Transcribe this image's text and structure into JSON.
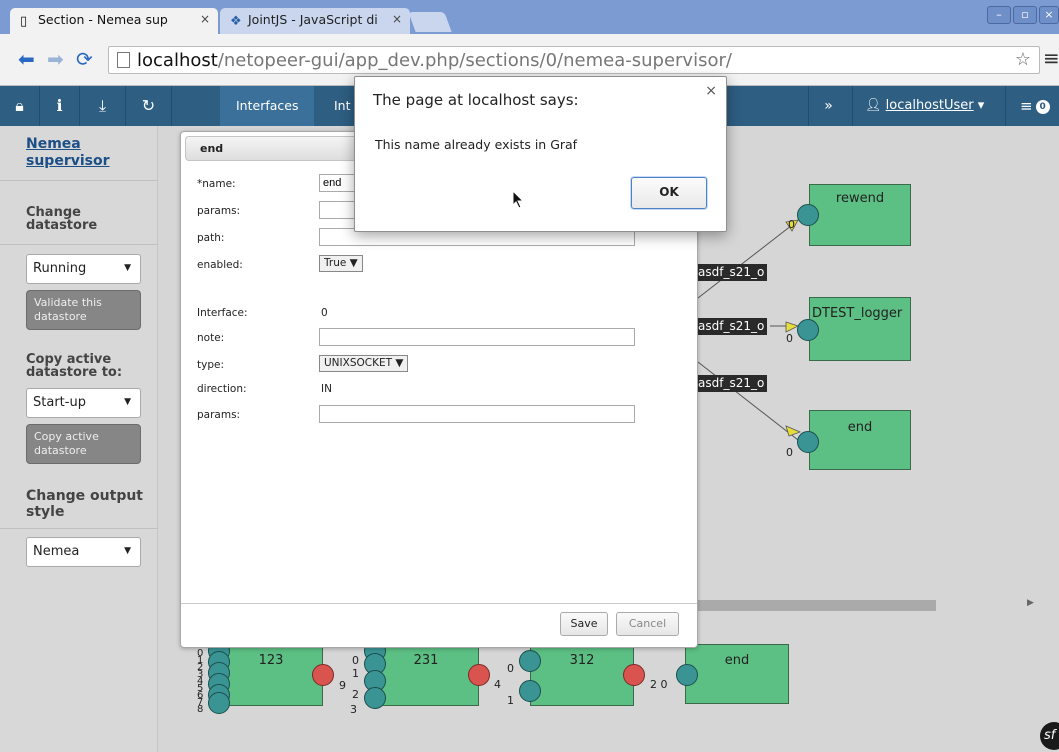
{
  "browser": {
    "tabs": [
      {
        "title": "Section - Nemea sup",
        "close": "×",
        "icon": "page-icon"
      },
      {
        "title": "JointJS - JavaScript di",
        "close": "×",
        "icon": "jointjs-icon"
      }
    ],
    "url_host": "localhost",
    "url_path": "/netopeer-gui/app_dev.php/sections/0/nemea-supervisor/",
    "window_buttons": [
      "–",
      "▫",
      "×"
    ]
  },
  "appbar": {
    "tabs": [
      "Interfaces",
      "Int"
    ],
    "user": "localhostUser",
    "badge": "0"
  },
  "sidebar": {
    "title": "Nemea supervisor",
    "change_datastore": "Change datastore",
    "datastore_value": "Running",
    "validate_label": "Validate this datastore",
    "copy_heading": "Copy active datastore to:",
    "copy_target": "Start-up",
    "copy_button": "Copy active datastore",
    "output_heading": "Change output style",
    "output_value": "Nemea"
  },
  "graph": {
    "nodes": [
      "rewend",
      "DTEST_logger",
      "end",
      "123",
      "231",
      "312",
      "end"
    ],
    "edge_labels": [
      "asdf_s21_o",
      "asdf_s21_o",
      "asdf_s21_o"
    ],
    "port_labels": {
      "p0": "0",
      "p1": "0",
      "p2": "0",
      "p3": "0",
      "p4": "1",
      "p5": "2",
      "p6": "3",
      "p7": "9",
      "p8": "0",
      "p9": "4",
      "p10": "1",
      "p11": "2 0",
      "stack": "0 1 2 3 4 5 6 7 8"
    }
  },
  "form": {
    "title": "end",
    "name_label": "*name:",
    "name_value": "end",
    "params_label": "params:",
    "path_label": "path:",
    "enabled_label": "enabled:",
    "enabled_value": "True ▼",
    "interface_label": "Interface:",
    "interface_value": "0",
    "note_label": "note:",
    "type_label": "type:",
    "type_value": "UNIXSOCKET ▼",
    "direction_label": "direction:",
    "direction_value": "IN",
    "params2_label": "params:",
    "save": "Save",
    "cancel": "Cancel"
  },
  "alert": {
    "title": "The page at localhost says:",
    "message": "This name already exists in Graf",
    "ok": "OK",
    "close": "×"
  }
}
